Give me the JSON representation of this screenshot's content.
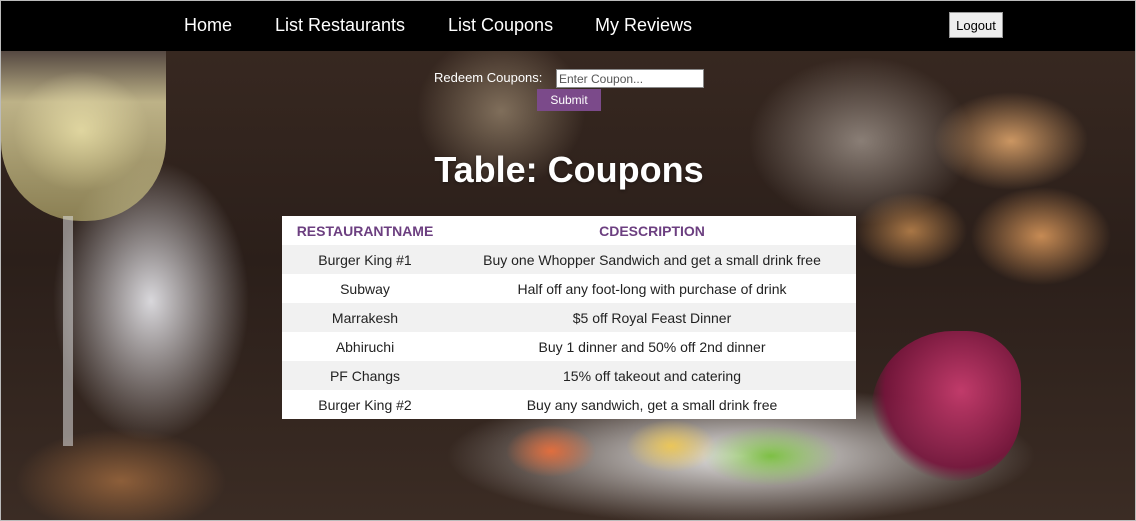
{
  "nav": {
    "links": [
      "Home",
      "List Restaurants",
      "List Coupons",
      "My Reviews"
    ],
    "logout_label": "Logout"
  },
  "redeem": {
    "label": "Redeem Coupons:",
    "placeholder": "Enter Coupon...",
    "value": "",
    "submit_label": "Submit"
  },
  "table": {
    "title": "Table: Coupons",
    "headers": [
      "RESTAURANTNAME",
      "CDESCRIPTION"
    ],
    "rows": [
      [
        "Burger King #1",
        "Buy one Whopper Sandwich and get a small drink free"
      ],
      [
        "Subway",
        "Half off any foot-long with purchase of drink"
      ],
      [
        "Marrakesh",
        "$5 off Royal Feast Dinner"
      ],
      [
        "Abhiruchi",
        "Buy 1 dinner and 50% off 2nd dinner"
      ],
      [
        "PF Changs",
        "15% off takeout and catering"
      ],
      [
        "Burger King #2",
        "Buy any sandwich, get a small drink free"
      ]
    ]
  },
  "colors": {
    "navbar_bg": "#000000",
    "accent_purple": "#7b4a8a",
    "header_text": "#6c3f80"
  }
}
